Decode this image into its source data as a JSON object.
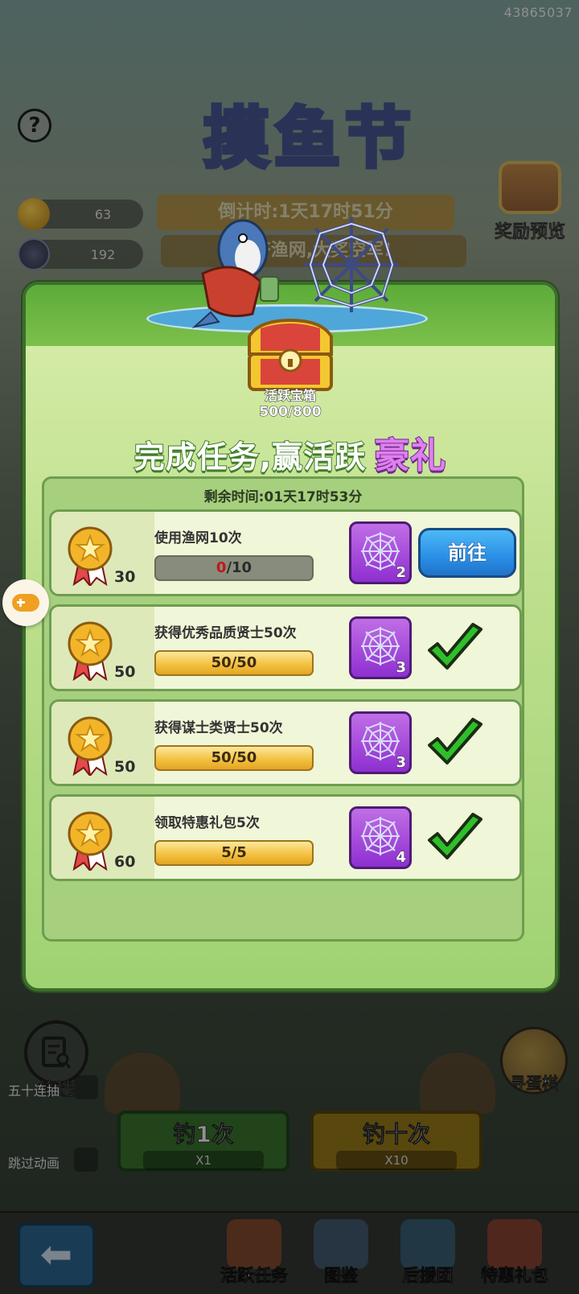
{
  "uid": "43865037",
  "background": {
    "event_title": "摸鱼节",
    "countdown_fragment": "倒计时:1天17时51分",
    "slogan_fragment": "集齐渔网,大奖空军!",
    "help_icon": "question-mark-icon",
    "resources": [
      {
        "icon": "gold-ingot-icon",
        "value": "63"
      },
      {
        "icon": "fishing-net-icon",
        "value": "192"
      }
    ],
    "reward_preview_label": "奖励预览",
    "filter_label": "筛选",
    "egg_label": "寻蛋棋",
    "option_fifty": "五十连抽",
    "option_skip": "跳过动画",
    "cast_one_label": "钓1次",
    "cast_one_cost": "X1",
    "cast_ten_label": "钓十次",
    "cast_ten_cost": "X10"
  },
  "popup": {
    "chest_label": "活跃宝箱",
    "chest_progress": "500/800",
    "headline_main": "完成任务,赢活跃",
    "headline_accent": "豪礼",
    "timer": "剩余时间:01天17时53分",
    "tasks": [
      {
        "name": "使用渔网10次",
        "points": "30",
        "progress_current": "0",
        "progress_total": "/10",
        "progress_fraction": 0,
        "reward_count": "2",
        "action": "前往",
        "completed": false
      },
      {
        "name": "获得优秀品质贤士50次",
        "points": "50",
        "progress": "50/50",
        "progress_fraction": 1,
        "reward_count": "3",
        "completed": true
      },
      {
        "name": "获得谋士类贤士50次",
        "points": "50",
        "progress": "50/50",
        "progress_fraction": 1,
        "reward_count": "3",
        "completed": true
      },
      {
        "name": "领取特惠礼包5次",
        "points": "60",
        "progress": "5/5",
        "progress_fraction": 1,
        "reward_count": "4",
        "completed": true
      }
    ]
  },
  "bottom_nav": [
    {
      "label": "活跃任务",
      "icon": "active-tasks-icon"
    },
    {
      "label": "图鉴",
      "icon": "album-icon"
    },
    {
      "label": "后援团",
      "icon": "support-group-icon"
    },
    {
      "label": "特惠礼包",
      "icon": "gift-pack-icon"
    }
  ],
  "colors": {
    "popup_green": "#bfe08f",
    "go_button_blue": "#2a8ee6",
    "reward_purple": "#8e2fd0",
    "progress_gold": "#f2bf3c",
    "check_green": "#2fbf2a",
    "accent_pink": "#e07ff0"
  }
}
